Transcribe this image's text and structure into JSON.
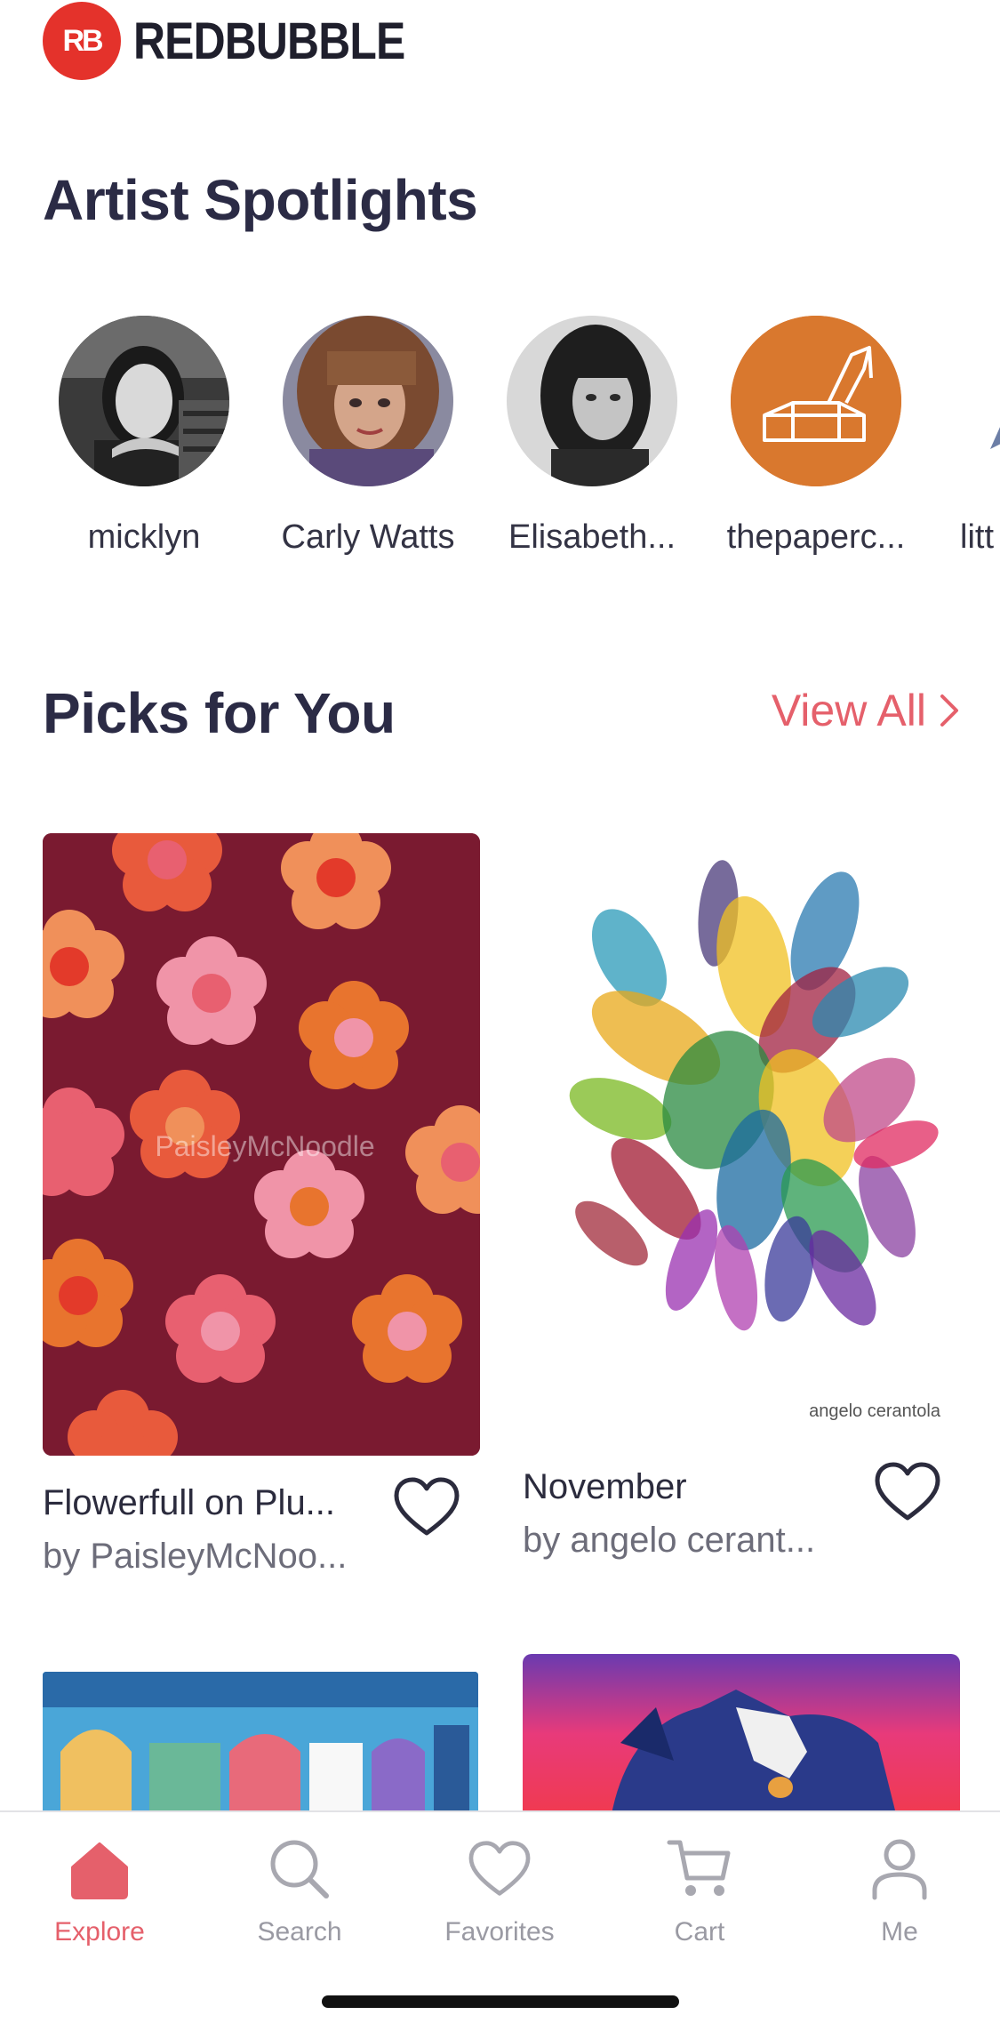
{
  "brand": {
    "logo_mark": "RB",
    "name": "REDBUBBLE"
  },
  "spotlights": {
    "title": "Artist Spotlights",
    "artists": [
      {
        "name": "micklyn"
      },
      {
        "name": "Carly Watts"
      },
      {
        "name": "Elisabeth..."
      },
      {
        "name": "thepaperc..."
      },
      {
        "name": "litt"
      }
    ]
  },
  "picks": {
    "title": "Picks for You",
    "view_all_label": "View All",
    "items": [
      {
        "title": "Flowerfull on Plu...",
        "artist": "by PaisleyMcNoo...",
        "watermark": "PaisleyMcNoodle"
      },
      {
        "title": "November",
        "artist": "by angelo cerant...",
        "watermark": "angelo cerantola"
      }
    ]
  },
  "nav": {
    "items": [
      {
        "label": "Explore",
        "icon": "home-icon",
        "active": true
      },
      {
        "label": "Search",
        "icon": "search-icon",
        "active": false
      },
      {
        "label": "Favorites",
        "icon": "heart-icon",
        "active": false
      },
      {
        "label": "Cart",
        "icon": "cart-icon",
        "active": false
      },
      {
        "label": "Me",
        "icon": "person-icon",
        "active": false
      }
    ]
  },
  "colors": {
    "accent": "#e5606b",
    "logo_red": "#e4322b",
    "title_text": "#2b2b45",
    "muted_text": "#6d6d7a"
  }
}
